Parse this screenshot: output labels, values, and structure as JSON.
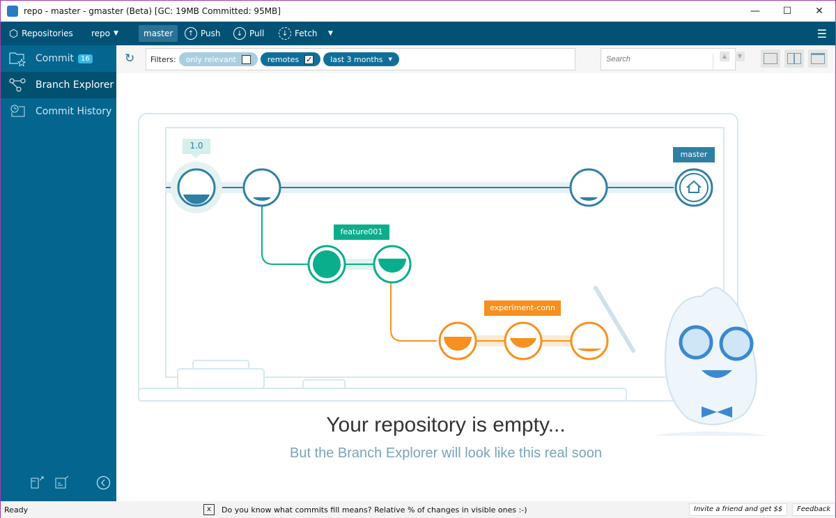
{
  "window": {
    "title": "repo - master - gmaster (Beta) [GC: 19MB Committed: 95MB]",
    "minimize": "—",
    "maximize": "☐",
    "close": "✕"
  },
  "toolbar": {
    "repositories": "Repositories",
    "repo": "repo",
    "branch": "master",
    "push": "Push",
    "pull": "Pull",
    "fetch": "Fetch"
  },
  "sidebar": {
    "items": [
      {
        "label": "Commit",
        "badge": "16"
      },
      {
        "label": "Branch Explorer"
      },
      {
        "label": "Commit History"
      }
    ]
  },
  "filters": {
    "label": "Filters:",
    "only_relevant": "only relevant",
    "only_relevant_checked": false,
    "remotes": "remotes",
    "remotes_checked": true,
    "range": "last 3 months"
  },
  "search": {
    "placeholder": "Search"
  },
  "illustration": {
    "tag": "1.0",
    "master": "master",
    "feature": "feature001",
    "experiment": "experiment-conn"
  },
  "empty": {
    "title": "Your repository is empty...",
    "subtitle": "But the Branch Explorer will look like this real soon"
  },
  "status": {
    "state": "Ready",
    "tip_close": "x",
    "tip": "Do you know what commits fill means? Relative % of changes in visible ones :-)",
    "invite": "Invite a friend and get $$",
    "feedback": "Feedback"
  },
  "colors": {
    "toolbar": "#025275",
    "sidebar": "#04668f",
    "master": "#2f7fa5",
    "feature": "#0bae8c",
    "experiment": "#f7901e"
  }
}
